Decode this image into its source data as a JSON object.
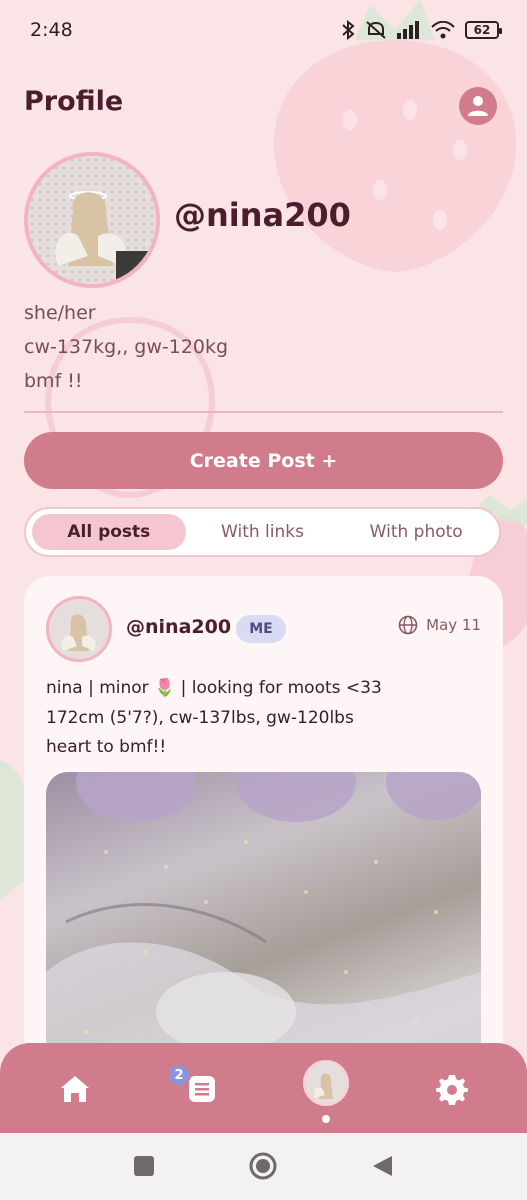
{
  "status_bar": {
    "time": "2:48",
    "battery": "62"
  },
  "header": {
    "title": "Profile"
  },
  "profile": {
    "username": "@nina200",
    "bio": [
      "she/her",
      "cw-137kg,, gw-120kg",
      "bmf !!"
    ]
  },
  "actions": {
    "create_post": "Create Post +"
  },
  "filters": {
    "tabs": [
      "All posts",
      "With links",
      "With photo"
    ],
    "active": "All posts"
  },
  "post": {
    "username": "@nina200",
    "badge": "ME",
    "date": "May 11",
    "lines": [
      "nina | minor 🌷 |  looking for moots <33",
      "172cm (5'7?), cw-137lbs, gw-120lbs",
      "heart to bmf!!"
    ]
  },
  "bottom_nav": {
    "messages_badge": "2"
  },
  "colors": {
    "accent": "#d17c8c",
    "background": "#fbe4e6",
    "badge": "#d9dbf3"
  },
  "icons": [
    "bluetooth-icon",
    "mute-icon",
    "signal-icon",
    "wifi-icon",
    "battery-icon",
    "user-circle-icon",
    "globe-icon",
    "home-icon",
    "list-icon",
    "gear-icon",
    "square-icon",
    "circle-icon",
    "back-icon"
  ]
}
